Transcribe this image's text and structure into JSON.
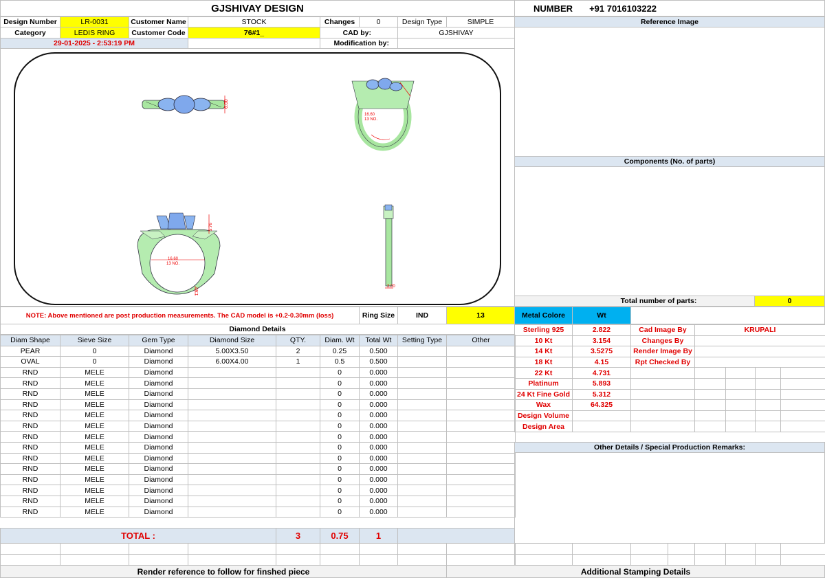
{
  "header": {
    "company": "GJSHIVAY DESIGN",
    "number_label": "NUMBER",
    "number_value": "+91 7016103222"
  },
  "info": {
    "design_number_label": "Design Number",
    "design_number": "LR-0031",
    "customer_name_label": "Customer Name",
    "customer_name": "STOCK",
    "changes_label": "Changes",
    "changes": "0",
    "design_type_label": "Design Type",
    "design_type": "SIMPLE",
    "category_label": "Category",
    "category": "LEDIS RING",
    "customer_code_label": "Customer Code",
    "customer_code": "76#1_",
    "cad_by_label": "CAD by:",
    "cad_by": "GJSHIVAY",
    "datetime": "29-01-2025 - 2:53:19 PM",
    "modification_label": "Modification by:"
  },
  "right_panels": {
    "reference_image": "Reference Image",
    "components": "Components (No. of parts)",
    "total_parts_label": "Total number of parts:",
    "total_parts": "0",
    "other_details": "Other Details / Special Production Remarks:"
  },
  "drawing": {
    "dim_top": "6.00",
    "dim_side": "5.76",
    "dim_inner_1": "16.60",
    "dim_inner_2": "13 NO.",
    "dim_bottom": "1.60",
    "dim_narrow": "2.00",
    "dim_persp": "16.60",
    "dim_persp_2": "13 NO."
  },
  "note": {
    "text": "NOTE: Above mentioned are post production measurements. The CAD model is +0.2-0.30mm (loss)",
    "ring_size_label": "Ring Size",
    "ring_size_std": "IND",
    "ring_size": "13"
  },
  "metal": {
    "colore_label": "Metal Colore",
    "wt_label": "Wt",
    "rows": [
      {
        "name": "Sterling 925",
        "wt": "2.822"
      },
      {
        "name": "10 Kt",
        "wt": "3.154"
      },
      {
        "name": "14 Kt",
        "wt": "3.5275"
      },
      {
        "name": "18 Kt",
        "wt": "4.15"
      },
      {
        "name": "22 Kt",
        "wt": "4.731"
      },
      {
        "name": "Platinum",
        "wt": "5.893"
      },
      {
        "name": "24 Kt Fine Gold",
        "wt": "5.312"
      },
      {
        "name": "Wax",
        "wt": "64.325"
      },
      {
        "name": "Design Volume",
        "wt": ""
      },
      {
        "name": "Design Area",
        "wt": ""
      }
    ],
    "credits": [
      {
        "label": "Cad Image By",
        "value": "KRUPALI"
      },
      {
        "label": "Changes By",
        "value": ""
      },
      {
        "label": "Render Image By",
        "value": ""
      },
      {
        "label": "Rpt Checked By",
        "value": ""
      }
    ]
  },
  "diamond": {
    "title": "Diamond Details",
    "headers": [
      "Diam Shape",
      "Sieve Size",
      "Gem Type",
      "Diamond Size",
      "QTY.",
      "Diam. Wt",
      "Total Wt",
      "Setting Type",
      "Other"
    ],
    "rows": [
      [
        "PEAR",
        "0",
        "Diamond",
        "5.00X3.50",
        "2",
        "0.25",
        "0.500",
        "",
        ""
      ],
      [
        "OVAL",
        "0",
        "Diamond",
        "6.00X4.00",
        "1",
        "0.5",
        "0.500",
        "",
        ""
      ],
      [
        "RND",
        "MELE",
        "Diamond",
        "",
        "",
        "0",
        "0.000",
        "",
        ""
      ],
      [
        "RND",
        "MELE",
        "Diamond",
        "",
        "",
        "0",
        "0.000",
        "",
        ""
      ],
      [
        "RND",
        "MELE",
        "Diamond",
        "",
        "",
        "0",
        "0.000",
        "",
        ""
      ],
      [
        "RND",
        "MELE",
        "Diamond",
        "",
        "",
        "0",
        "0.000",
        "",
        ""
      ],
      [
        "RND",
        "MELE",
        "Diamond",
        "",
        "",
        "0",
        "0.000",
        "",
        ""
      ],
      [
        "RND",
        "MELE",
        "Diamond",
        "",
        "",
        "0",
        "0.000",
        "",
        ""
      ],
      [
        "RND",
        "MELE",
        "Diamond",
        "",
        "",
        "0",
        "0.000",
        "",
        ""
      ],
      [
        "RND",
        "MELE",
        "Diamond",
        "",
        "",
        "0",
        "0.000",
        "",
        ""
      ],
      [
        "RND",
        "MELE",
        "Diamond",
        "",
        "",
        "0",
        "0.000",
        "",
        ""
      ],
      [
        "RND",
        "MELE",
        "Diamond",
        "",
        "",
        "0",
        "0.000",
        "",
        ""
      ],
      [
        "RND",
        "MELE",
        "Diamond",
        "",
        "",
        "0",
        "0.000",
        "",
        ""
      ],
      [
        "RND",
        "MELE",
        "Diamond",
        "",
        "",
        "0",
        "0.000",
        "",
        ""
      ],
      [
        "RND",
        "MELE",
        "Diamond",
        "",
        "",
        "0",
        "0.000",
        "",
        ""
      ],
      [
        "RND",
        "MELE",
        "Diamond",
        "",
        "",
        "0",
        "0.000",
        "",
        ""
      ]
    ],
    "total_label": "TOTAL :",
    "total_qty": "3",
    "total_diam_wt": "0.75",
    "total_wt": "1"
  },
  "footer": {
    "render_ref": "Render reference to follow for finshed piece",
    "stamping": "Additional Stamping Details"
  }
}
